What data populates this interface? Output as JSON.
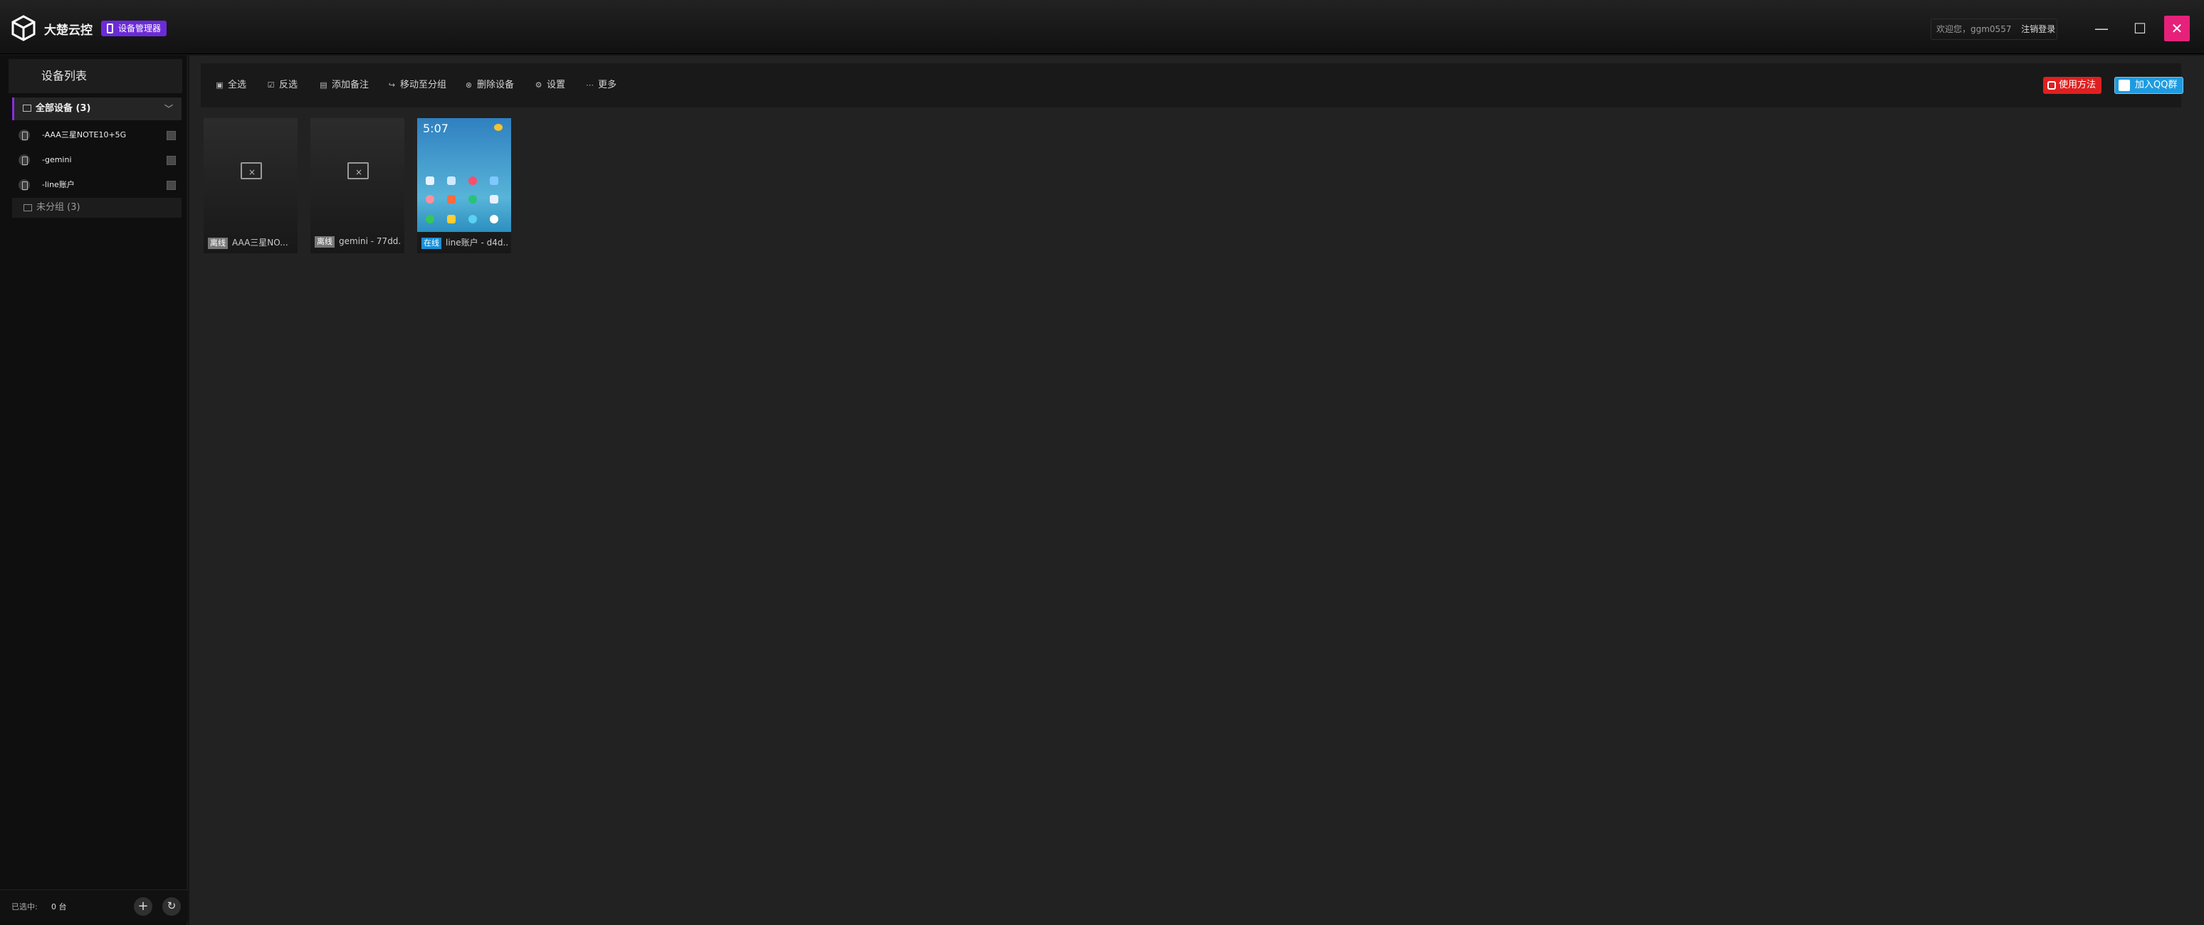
{
  "app": {
    "title": "大楚云控",
    "badge": "设备管理器",
    "welcome": "欢迎您，ggm0557",
    "logout": "注销登录"
  },
  "window": {
    "minimize": "—",
    "maximize": "☐",
    "close": "✕"
  },
  "sidebar": {
    "title": "设备列表",
    "group_all": "全部设备 (3)",
    "devices": [
      {
        "label": "-AAA三星NOTE10+5G"
      },
      {
        "label": "-gemini"
      },
      {
        "label": "-line账户"
      }
    ],
    "group_none": "未分组 (3)",
    "selected_label": "已选中:",
    "selected_count": "0 台"
  },
  "toolbar": {
    "select_all": "全选",
    "invert": "反选",
    "add_note": "添加备注",
    "move_group": "移动至分组",
    "delete_device": "删除设备",
    "settings": "设置",
    "more": "更多",
    "help": "使用方法",
    "join_qq": "加入QQ群"
  },
  "cards": [
    {
      "status": "离线",
      "name": "AAA三星NO..."
    },
    {
      "status": "离线",
      "name": "gemini - 77dd..."
    },
    {
      "status": "在线",
      "name": "line账户 - d4d..."
    }
  ],
  "phone": {
    "time": "5:07"
  },
  "colors": {
    "accent": "#8a2be2",
    "close": "#e6217a",
    "online": "#1a8fd8",
    "help": "#e02020",
    "qq": "#1e9be0"
  }
}
